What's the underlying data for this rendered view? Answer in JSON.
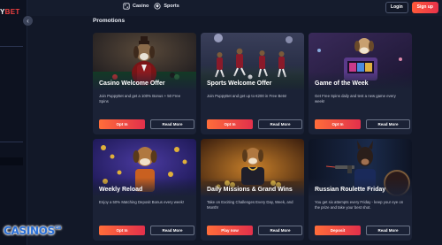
{
  "brand": {
    "logo_main": "Y",
    "logo_accent": "BET"
  },
  "topnav": [
    {
      "label": "Casino",
      "icon": "casino-icon"
    },
    {
      "label": "Sports",
      "icon": "sports-icon"
    }
  ],
  "auth": {
    "login": "Login",
    "signup": "Sign up"
  },
  "section_title": "Promotions",
  "cards": [
    {
      "title": "Casino Welcome Offer",
      "desc": "Join PuppyBet and get a 100% Bonus + 50 Free Spins",
      "primary": "Opt In",
      "secondary": "Read More",
      "theme": "casino-dog"
    },
    {
      "title": "Sports Welcome Offer",
      "desc": "Join PuppyBet and get up to €200 in Free Bets!",
      "primary": "Opt In",
      "secondary": "Read More",
      "theme": "soccer"
    },
    {
      "title": "Game of the Week",
      "desc": "Get Free Spins daily and test a new game every week!",
      "primary": "Opt In",
      "secondary": "Read More",
      "theme": "slot-dog"
    },
    {
      "title": "Weekly Reload",
      "desc": "Enjoy a 50% Matching Deposit Bonus every week!",
      "primary": "Opt In",
      "secondary": "Read More",
      "theme": "coins-dog"
    },
    {
      "title": "Daily Missions & Grand Wins",
      "desc": "Take on Exciting Challenges Every Day, Week, and Month!",
      "primary": "Play now",
      "secondary": "Read More",
      "theme": "gold-dog"
    },
    {
      "title": "Russian Roulette Friday",
      "desc": "You get six attempts every Friday - keep your eye on the prize and take your best shot.",
      "primary": "Deposit",
      "secondary": "Read More",
      "theme": "roulette-dog"
    }
  ],
  "watermark": {
    "text": "CASINOS",
    "suffix": "ca"
  },
  "colors": {
    "accent_start": "#ff6d3a",
    "accent_end": "#e2304b",
    "background": "#121828",
    "card": "#1b2236"
  }
}
